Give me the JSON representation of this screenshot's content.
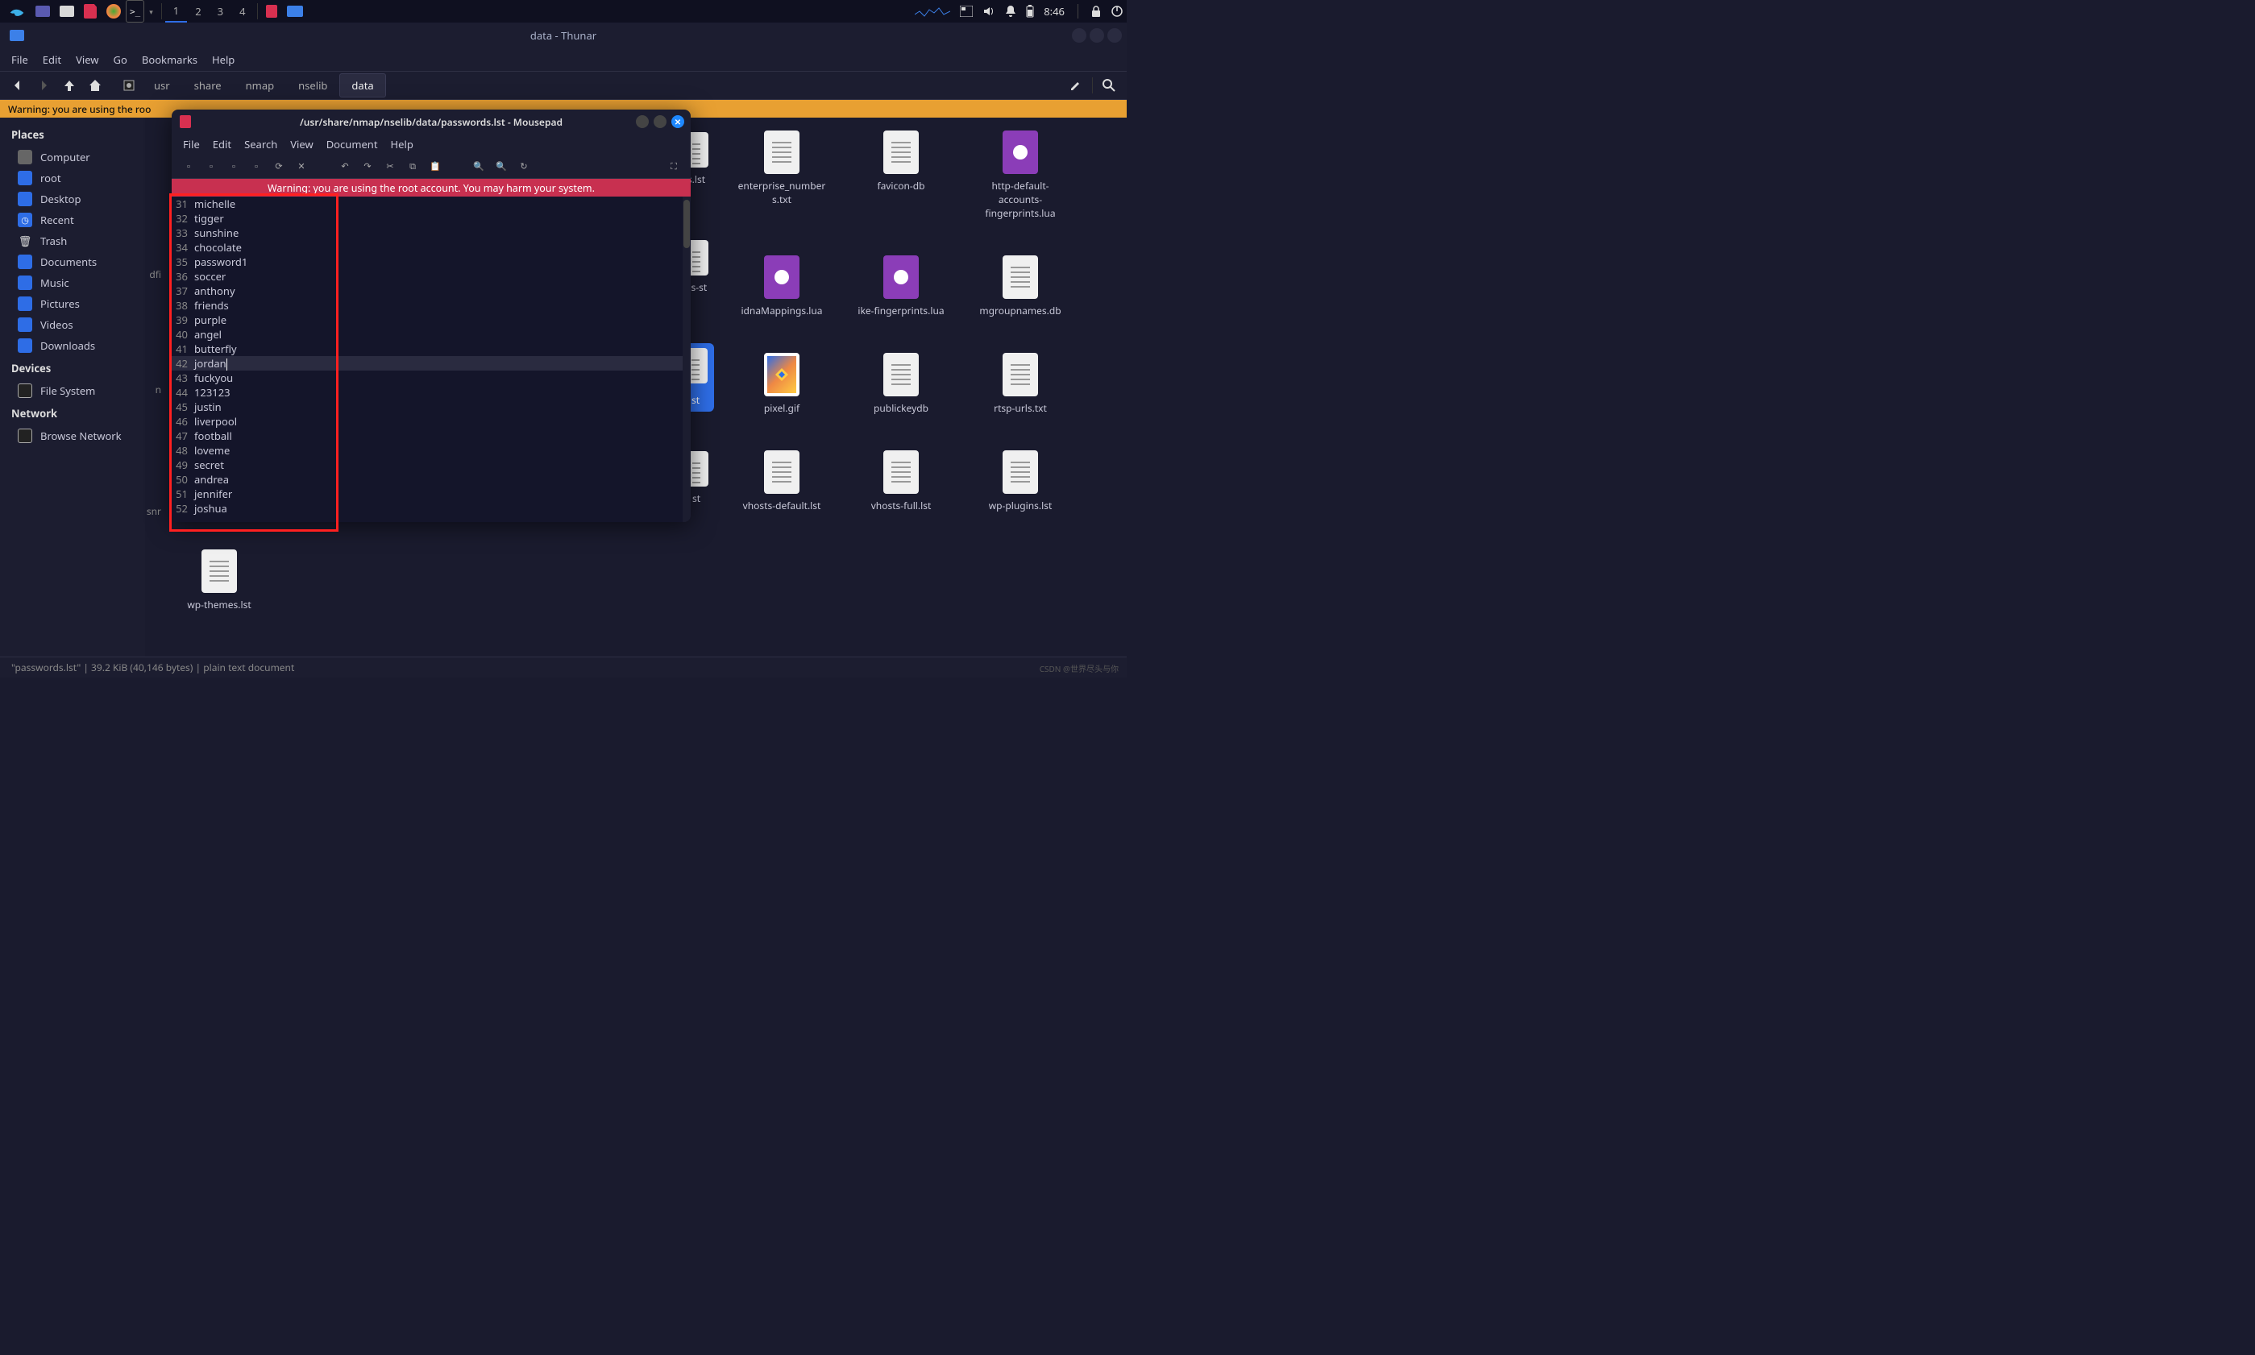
{
  "panel": {
    "workspaces": [
      "1",
      "2",
      "3",
      "4"
    ],
    "active_workspace": 0,
    "clock": "8:46"
  },
  "thunar": {
    "title": "data - Thunar",
    "menu": [
      "File",
      "Edit",
      "View",
      "Go",
      "Bookmarks",
      "Help"
    ],
    "breadcrumb": [
      "usr",
      "share",
      "nmap",
      "nselib",
      "data"
    ],
    "warning": "Warning: you are using the roo",
    "sidebar": {
      "places_heading": "Places",
      "places": [
        {
          "label": "Computer",
          "icon": "computer"
        },
        {
          "label": "root",
          "icon": "folder"
        },
        {
          "label": "Desktop",
          "icon": "folder"
        },
        {
          "label": "Recent",
          "icon": "recent"
        },
        {
          "label": "Trash",
          "icon": "trash"
        },
        {
          "label": "Documents",
          "icon": "folder"
        },
        {
          "label": "Music",
          "icon": "folder"
        },
        {
          "label": "Pictures",
          "icon": "folder"
        },
        {
          "label": "Videos",
          "icon": "folder"
        },
        {
          "label": "Downloads",
          "icon": "folder"
        }
      ],
      "devices_heading": "Devices",
      "devices": [
        {
          "label": "File System",
          "icon": "filesys"
        }
      ],
      "network_heading": "Network",
      "network": [
        {
          "label": "Browse Network",
          "icon": "filesys"
        }
      ]
    },
    "files_partial_left": [
      {
        "name": "s.lst",
        "type": "text"
      },
      {
        "name": "es-st",
        "type": "text"
      },
      {
        "name": "st",
        "type": "text",
        "selected": true
      },
      {
        "name": "st",
        "type": "text"
      }
    ],
    "files_partial_left_prefix": [
      {
        "name": "dfi"
      },
      {
        "name": "n"
      },
      {
        "name": "snr"
      }
    ],
    "files": [
      {
        "name": "enterprise_numbers.txt",
        "type": "text"
      },
      {
        "name": "favicon-db",
        "type": "text"
      },
      {
        "name": "http-default-accounts-fingerprints.lua",
        "type": "lua"
      },
      {
        "name": "idnaMappings.lua",
        "type": "lua"
      },
      {
        "name": "ike-fingerprints.lua",
        "type": "lua"
      },
      {
        "name": "mgroupnames.db",
        "type": "text"
      },
      {
        "name": "pixel.gif",
        "type": "gif"
      },
      {
        "name": "publickeydb",
        "type": "text"
      },
      {
        "name": "rtsp-urls.txt",
        "type": "text"
      },
      {
        "name": "vhosts-default.lst",
        "type": "text"
      },
      {
        "name": "vhosts-full.lst",
        "type": "text"
      },
      {
        "name": "wp-plugins.lst",
        "type": "text"
      }
    ],
    "files_extra": [
      {
        "name": "wp-themes.lst",
        "type": "text"
      }
    ],
    "status": "\"passwords.lst\"  |  39.2 KiB (40,146 bytes)  |  plain text document"
  },
  "mousepad": {
    "title": "/usr/share/nmap/nselib/data/passwords.lst - Mousepad",
    "menu": [
      "File",
      "Edit",
      "Search",
      "View",
      "Document",
      "Help"
    ],
    "warning": "Warning: you are using the root account. You may harm your system.",
    "cursor_line": 42,
    "lines": [
      {
        "n": 31,
        "t": "michelle"
      },
      {
        "n": 32,
        "t": "tigger"
      },
      {
        "n": 33,
        "t": "sunshine"
      },
      {
        "n": 34,
        "t": "chocolate"
      },
      {
        "n": 35,
        "t": "password1"
      },
      {
        "n": 36,
        "t": "soccer"
      },
      {
        "n": 37,
        "t": "anthony"
      },
      {
        "n": 38,
        "t": "friends"
      },
      {
        "n": 39,
        "t": "purple"
      },
      {
        "n": 40,
        "t": "angel"
      },
      {
        "n": 41,
        "t": "butterfly"
      },
      {
        "n": 42,
        "t": "jordan"
      },
      {
        "n": 43,
        "t": "fuckyou"
      },
      {
        "n": 44,
        "t": "123123"
      },
      {
        "n": 45,
        "t": "justin"
      },
      {
        "n": 46,
        "t": "liverpool"
      },
      {
        "n": 47,
        "t": "football"
      },
      {
        "n": 48,
        "t": "loveme"
      },
      {
        "n": 49,
        "t": "secret"
      },
      {
        "n": 50,
        "t": "andrea"
      },
      {
        "n": 51,
        "t": "jennifer"
      },
      {
        "n": 52,
        "t": "joshua"
      }
    ]
  },
  "watermark": "CSDN @世界尽头与你"
}
